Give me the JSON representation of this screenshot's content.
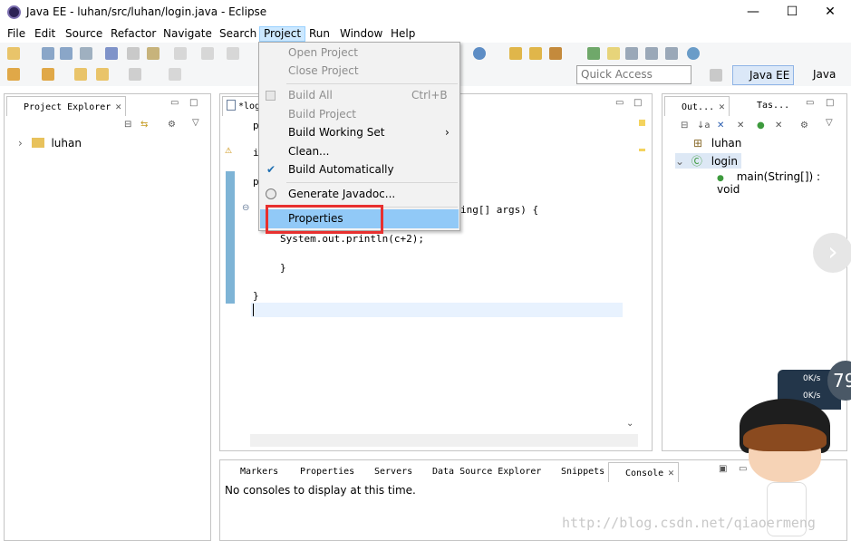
{
  "window": {
    "title": "Java EE - luhan/src/luhan/login.java - Eclipse",
    "controls": [
      "—",
      "☐",
      "✕"
    ]
  },
  "menubar": [
    "File",
    "Edit",
    "Source",
    "Refactor",
    "Navigate",
    "Search",
    "Project",
    "Run",
    "Window",
    "Help"
  ],
  "active_menu": "Project",
  "quick_access": {
    "placeholder": "Quick Access"
  },
  "perspectives": {
    "java_ee": "Java EE",
    "java": "Java"
  },
  "project_explorer": {
    "tab": "Project Explorer",
    "items": [
      "luhan"
    ]
  },
  "editor": {
    "tab": "*log",
    "lines": [
      "p",
      "i",
      "p",
      "ing[] args) {",
      "System.out.println(c+2);",
      "}",
      "}"
    ]
  },
  "project_menu": {
    "items": [
      {
        "label": "Open Project",
        "enabled": false
      },
      {
        "label": "Close Project",
        "enabled": false
      },
      {
        "label": "Build All",
        "shortcut": "Ctrl+B",
        "enabled": false
      },
      {
        "label": "Build Project",
        "enabled": false
      },
      {
        "label": "Build Working Set",
        "submenu": true,
        "enabled": true
      },
      {
        "label": "Clean...",
        "enabled": true
      },
      {
        "label": "Build Automatically",
        "checked": true,
        "enabled": true
      },
      {
        "label": "Generate Javadoc...",
        "enabled": true
      },
      {
        "label": "Properties",
        "enabled": true,
        "highlighted": true
      }
    ]
  },
  "outline": {
    "tab1": "Out...",
    "tab2": "Tas...",
    "items": [
      "luhan",
      "login",
      "main(String[]) : void"
    ]
  },
  "bottom_tabs": [
    "Markers",
    "Properties",
    "Servers",
    "Data Source Explorer",
    "Snippets",
    "Console"
  ],
  "console": {
    "message": "No consoles to display at this time."
  },
  "overlay": {
    "watermark": "http://blog.csdn.net/qiaoermeng",
    "net_up": "0K/s",
    "net_down": "0K/s",
    "gauge": "79"
  },
  "colors": {
    "highlight": "#91c9f7",
    "annotation": "#e8302f",
    "menu_active": "#cce8ff"
  }
}
